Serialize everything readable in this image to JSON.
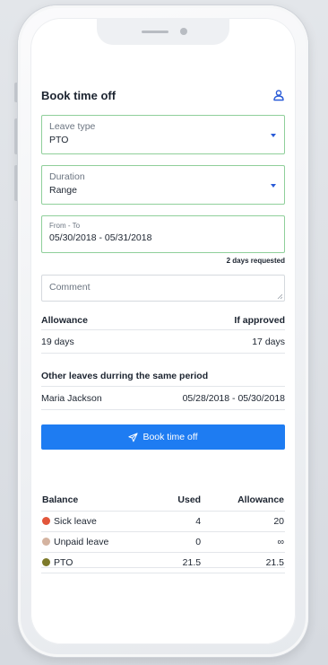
{
  "header": {
    "title": "Book time off",
    "user_icon": "user-icon"
  },
  "leave_type": {
    "label": "Leave type",
    "value": "PTO"
  },
  "duration": {
    "label": "Duration",
    "value": "Range"
  },
  "date_range": {
    "label": "From - To",
    "value": "05/30/2018 - 05/31/2018",
    "days_requested": "2 days requested"
  },
  "comment": {
    "placeholder": "Comment"
  },
  "allowance": {
    "header_left": "Allowance",
    "header_right": "If approved",
    "value_left": "19 days",
    "value_right": "17 days"
  },
  "other_leaves": {
    "title": "Other leaves durring the same period",
    "rows": [
      {
        "name": "Maria Jackson",
        "period": "05/28/2018 - 05/30/2018"
      }
    ]
  },
  "book_button": {
    "label": "Book time off",
    "icon": "send-icon",
    "color": "#1e7cf2"
  },
  "balance": {
    "headers": [
      "Balance",
      "Used",
      "Allowance"
    ],
    "rows": [
      {
        "name": "Sick leave",
        "color": "#e2563b",
        "used": "4",
        "allowance": "20"
      },
      {
        "name": "Unpaid leave",
        "color": "#d4b3a0",
        "used": "0",
        "allowance": "∞"
      },
      {
        "name": "PTO",
        "color": "#7d7a2a",
        "used": "21.5",
        "allowance": "21.5"
      }
    ]
  },
  "colors": {
    "accent": "#1e7cf2",
    "field_border": "#8fcf9a"
  }
}
